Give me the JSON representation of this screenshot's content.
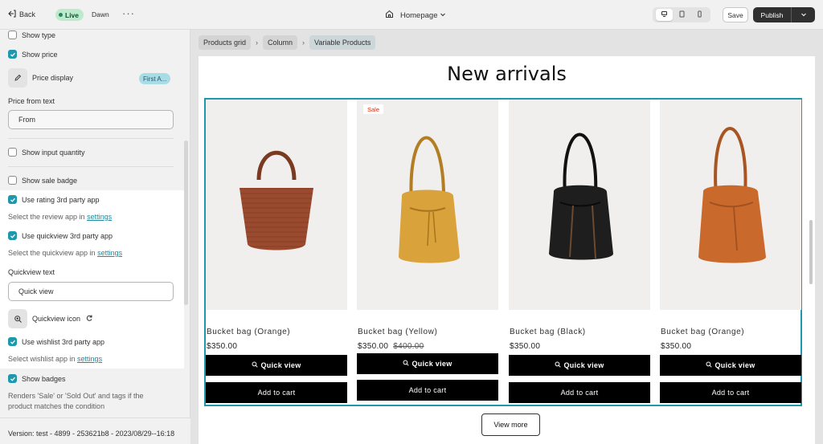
{
  "topbar": {
    "back_label": "Back",
    "live_label": "Live",
    "theme_name": "Dawn",
    "more_label": "···",
    "page_label": "Homepage",
    "save_label": "Save",
    "publish_label": "Publish"
  },
  "panel": {
    "show_type": "Show type",
    "show_price": "Show price",
    "price_display_label": "Price display",
    "price_display_value": "First A...",
    "price_from_text_label": "Price from text",
    "price_from_text_value": "From",
    "show_input_quantity": "Show input quantity",
    "show_sale_badge": "Show sale badge",
    "use_rating": "Use rating 3rd party app",
    "review_helper": "Select the review app in ",
    "review_helper_link": "settings",
    "use_quickview": "Use quickview 3rd party app",
    "quickview_helper": "Select the quickview app in ",
    "quickview_helper_link": "settings",
    "quickview_text_label": "Quickview text",
    "quickview_text_value": "Quick view",
    "quickview_icon_label": "Quickview icon",
    "use_wishlist": "Use wishlist 3rd party app",
    "wishlist_helper": "Select wishlist app in ",
    "wishlist_helper_link": "settings",
    "show_badges": "Show badges",
    "badges_helper": "Renders 'Sale' or 'Sold Out' and tags if the product matches the condition",
    "version": "Version: test - 4899 - 253621b8 - 2023/08/29--16:18"
  },
  "checkbox_states": {
    "show_type": false,
    "show_price": true,
    "show_input_quantity": false,
    "show_sale_badge": false,
    "use_rating": true,
    "use_quickview": true,
    "use_wishlist": true,
    "show_badges": true
  },
  "breadcrumbs": [
    "Products grid",
    "Column",
    "Variable Products"
  ],
  "section_heading": "New arrivals",
  "products": [
    {
      "name": "Bucket bag (Orange)",
      "price": "$350.00",
      "compare_price": "",
      "sale": false,
      "bag_color": "#9a4a2e"
    },
    {
      "name": "Bucket bag (Yellow)",
      "price": "$350.00",
      "compare_price": "$400.00",
      "sale": true,
      "bag_color": "#d9a23a"
    },
    {
      "name": "Bucket bag (Black)",
      "price": "$350.00",
      "compare_price": "",
      "sale": false,
      "bag_color": "#1e1e1e"
    },
    {
      "name": "Bucket bag (Orange)",
      "price": "$350.00",
      "compare_price": "",
      "sale": false,
      "bag_color": "#c96a2c"
    }
  ],
  "sale_badge": "Sale",
  "quick_view_label": "Quick view",
  "add_to_cart_label": "Add to cart",
  "view_more_label": "View more",
  "accent_color": "#1f98ad"
}
